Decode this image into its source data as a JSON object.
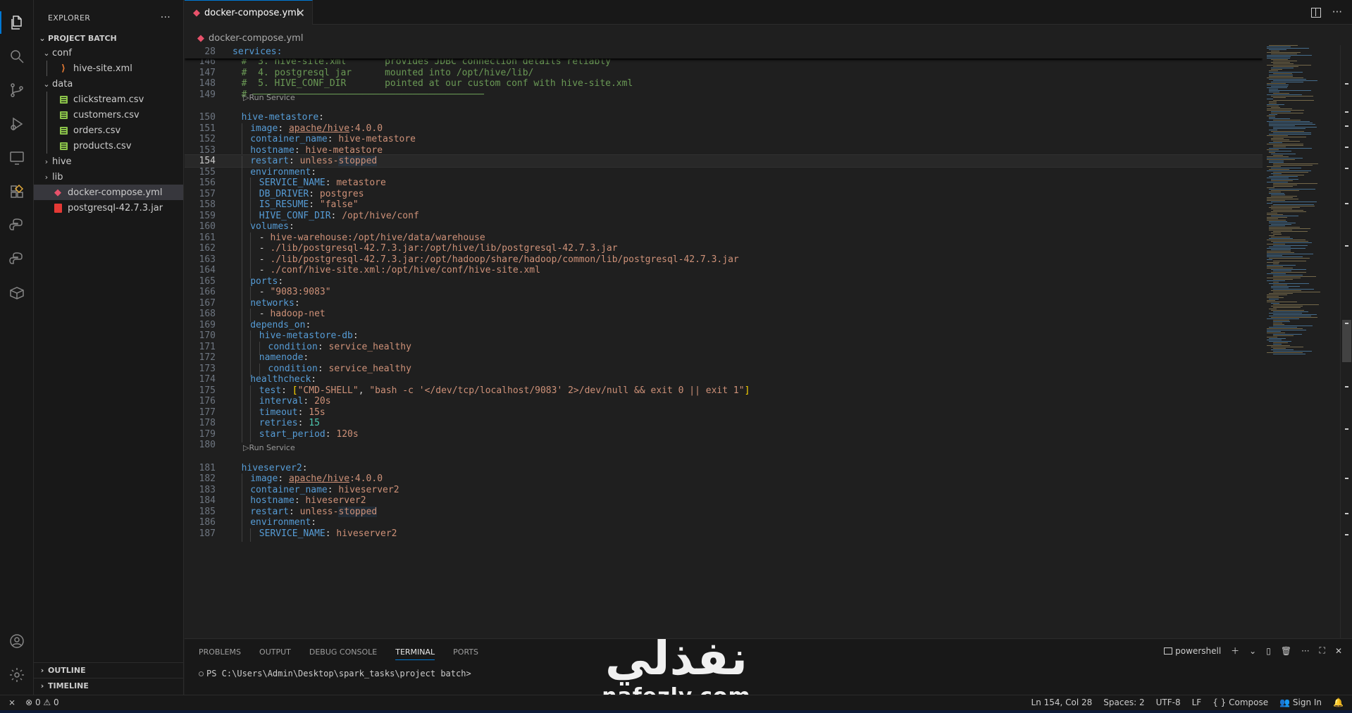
{
  "sidebar": {
    "title": "EXPLORER",
    "more": "···",
    "project": "PROJECT BATCH",
    "tree": [
      {
        "label": "conf",
        "type": "folder",
        "depth": 0,
        "open": true
      },
      {
        "label": "hive-site.xml",
        "type": "xml",
        "depth": 1
      },
      {
        "label": "data",
        "type": "folder",
        "depth": 0,
        "open": true
      },
      {
        "label": "clickstream.csv",
        "type": "csv",
        "depth": 1
      },
      {
        "label": "customers.csv",
        "type": "csv",
        "depth": 1
      },
      {
        "label": "orders.csv",
        "type": "csv",
        "depth": 1
      },
      {
        "label": "products.csv",
        "type": "csv",
        "depth": 1
      },
      {
        "label": "hive",
        "type": "folder",
        "depth": 0,
        "open": false
      },
      {
        "label": "lib",
        "type": "folder",
        "depth": 0,
        "open": false
      },
      {
        "label": "docker-compose.yml",
        "type": "docker",
        "depth": 0,
        "selected": true
      },
      {
        "label": "postgresql-42.7.3.jar",
        "type": "jar",
        "depth": 0
      }
    ],
    "outline": "OUTLINE",
    "timeline": "TIMELINE"
  },
  "tab": {
    "label": "docker-compose.yml",
    "close": "✕"
  },
  "breadcrumb": "docker-compose.yml",
  "editor": {
    "sticky": {
      "num": "28",
      "text": "services:"
    },
    "codelens": "Run Service",
    "current_line": "154"
  },
  "panel": {
    "tabs": [
      "PROBLEMS",
      "OUTPUT",
      "DEBUG CONSOLE",
      "TERMINAL",
      "PORTS"
    ],
    "active_tab": "TERMINAL",
    "shell": "powershell",
    "prompt": "PS C:\\Users\\Admin\\Desktop\\spark_tasks\\project batch>"
  },
  "watermark": {
    "arabic": "نفذلي",
    "latin": "nafezly.com"
  },
  "status": {
    "errors": "0",
    "warnings": "0",
    "position": "Ln 154, Col 28",
    "spaces": "Spaces: 2",
    "encoding": "UTF-8",
    "eol": "LF",
    "language": "Compose",
    "sign_in": "Sign In"
  },
  "colors": {
    "accent": "#0078d4",
    "background": "#1f1f1f",
    "sidebar": "#181818"
  }
}
